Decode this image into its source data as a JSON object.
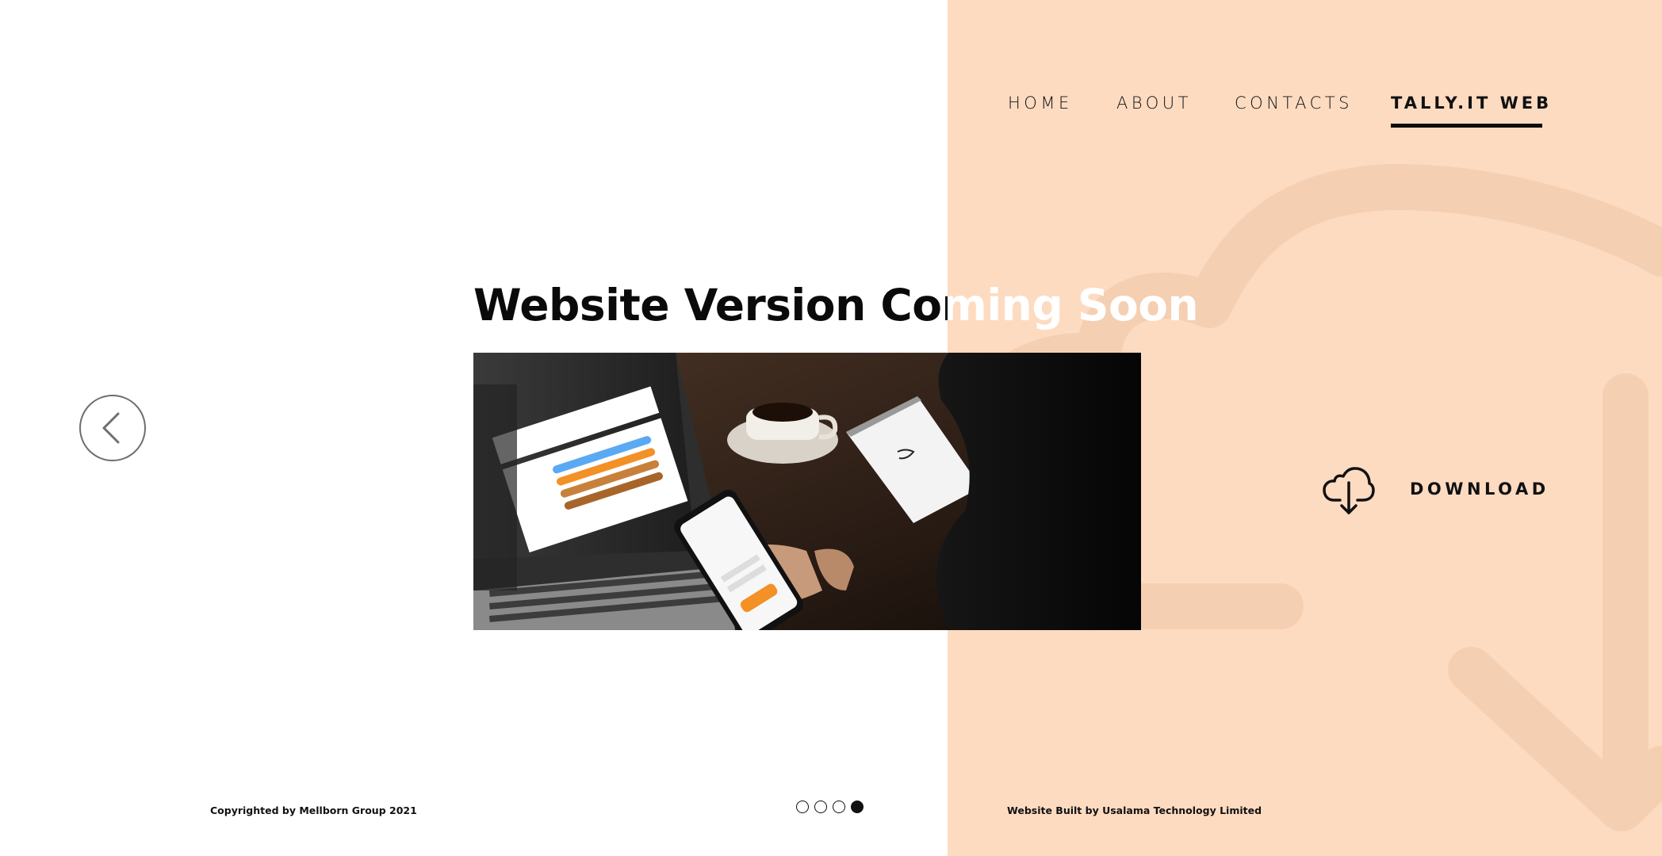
{
  "nav": {
    "items": [
      {
        "label": "HOME"
      },
      {
        "label": "ABOUT"
      },
      {
        "label": "CONTACTS"
      },
      {
        "label": "TALLY.IT WEB"
      }
    ],
    "active": "TALLY.IT WEB"
  },
  "hero": {
    "headline": "Website Version Coming Soon",
    "image_alt": "Laptop and phone showing Tally.it app on a cafe table"
  },
  "download": {
    "label": "DOWNLOAD",
    "icon": "cloud-download-icon"
  },
  "footer": {
    "left": "Copyrighted by Mellborn Group 2021",
    "right": "Website Built by Usalama Technology Limited"
  },
  "pagination": {
    "total": 4,
    "active_index": 3
  },
  "colors": {
    "accent_panel": "#fddbc1",
    "text": "#111111",
    "orange": "#f39026",
    "blue": "#5aa9f2"
  }
}
